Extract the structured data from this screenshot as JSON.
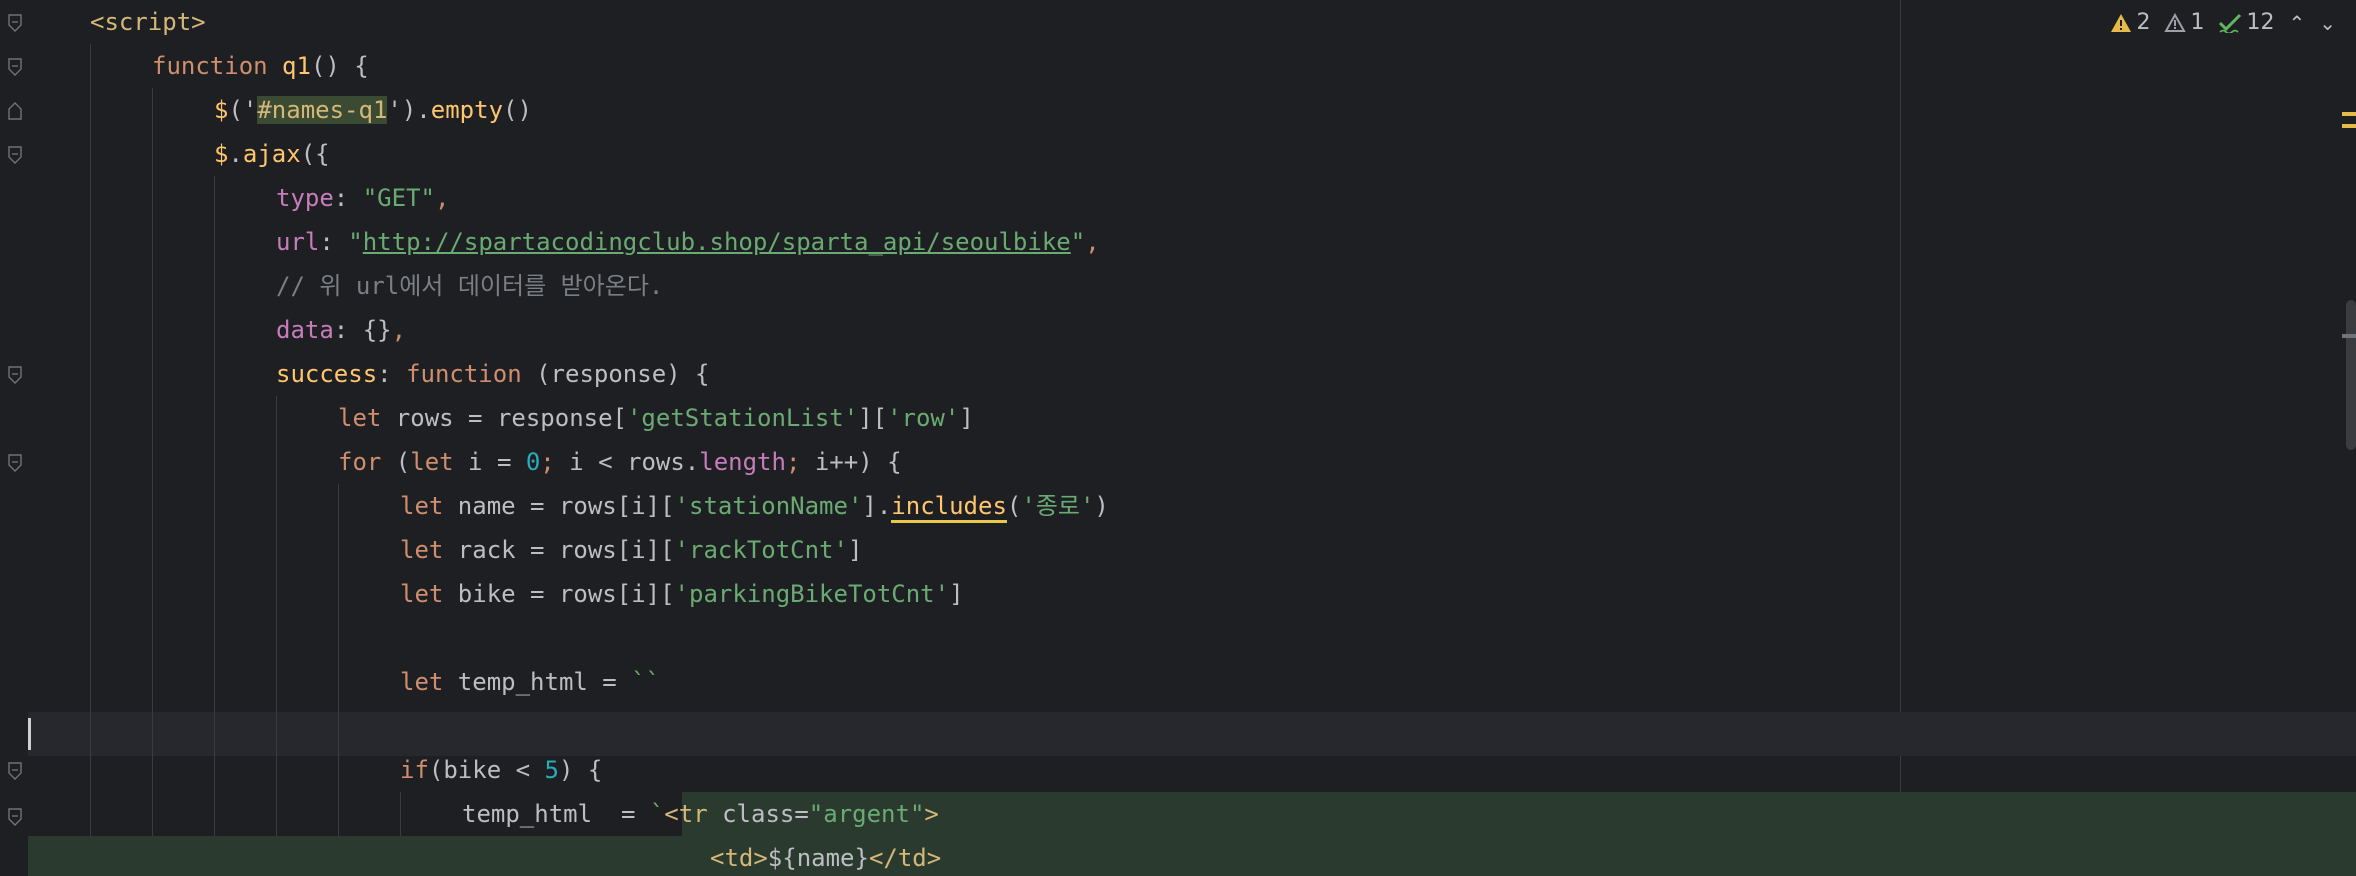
{
  "inspections": {
    "warnings": "2",
    "weak_warnings": "1",
    "typos": "12"
  },
  "code_lines": [
    [
      [
        "t-tag",
        "<script>"
      ]
    ],
    [
      [
        "t-kw",
        "function "
      ],
      [
        "t-call",
        "q1"
      ],
      [
        "t-text",
        "() {"
      ]
    ],
    [
      [
        "t-call",
        "$"
      ],
      [
        "t-text",
        "('"
      ],
      [
        "t-hl",
        "#names-q1"
      ],
      [
        "t-text",
        "')."
      ],
      [
        "t-call",
        "empty"
      ],
      [
        "t-text",
        "()"
      ]
    ],
    [
      [
        "t-call",
        "$"
      ],
      [
        "t-text",
        "."
      ],
      [
        "t-call",
        "ajax"
      ],
      [
        "t-text",
        "({"
      ]
    ],
    [
      [
        "t-prop",
        "type"
      ],
      [
        "t-text",
        ": "
      ],
      [
        "t-str",
        "\"GET\""
      ],
      [
        "t-kw",
        ","
      ]
    ],
    [
      [
        "t-prop",
        "url"
      ],
      [
        "t-text",
        ": "
      ],
      [
        "t-str",
        "\""
      ],
      [
        "t-link",
        "http://spartacodingclub.shop/sparta_api/seoulbike"
      ],
      [
        "t-str",
        "\""
      ],
      [
        "t-kw",
        ","
      ]
    ],
    [
      [
        "t-com",
        "// 위 url에서 데이터를 받아온다."
      ]
    ],
    [
      [
        "t-prop",
        "data"
      ],
      [
        "t-text",
        ": {}"
      ],
      [
        "t-kw",
        ","
      ]
    ],
    [
      [
        "t-call",
        "success"
      ],
      [
        "t-text",
        ": "
      ],
      [
        "t-kw",
        "function "
      ],
      [
        "t-text",
        "(response) {"
      ]
    ],
    [
      [
        "t-kw",
        "let "
      ],
      [
        "t-text",
        "rows = response["
      ],
      [
        "t-str",
        "'getStationList'"
      ],
      [
        "t-text",
        "]["
      ],
      [
        "t-str",
        "'row'"
      ],
      [
        "t-text",
        "]"
      ]
    ],
    [
      [
        "t-kw",
        "for "
      ],
      [
        "t-text",
        "("
      ],
      [
        "t-kw",
        "let "
      ],
      [
        "t-text",
        "i = "
      ],
      [
        "t-num",
        "0"
      ],
      [
        "t-kw",
        "; "
      ],
      [
        "t-text",
        "i < rows."
      ],
      [
        "t-prop",
        "length"
      ],
      [
        "t-kw",
        "; "
      ],
      [
        "t-text",
        "i++) {"
      ]
    ],
    [
      [
        "t-kw",
        "let "
      ],
      [
        "t-text",
        "name = rows[i]["
      ],
      [
        "t-str",
        "'stationName'"
      ],
      [
        "t-text",
        "]."
      ],
      [
        "t-warn",
        "includes"
      ],
      [
        "t-text",
        "("
      ],
      [
        "t-str",
        "'종로'"
      ],
      [
        "t-text",
        ")"
      ]
    ],
    [
      [
        "t-kw",
        "let "
      ],
      [
        "t-text",
        "rack = rows[i]["
      ],
      [
        "t-str",
        "'rackTotCnt'"
      ],
      [
        "t-text",
        "]"
      ]
    ],
    [
      [
        "t-kw",
        "let "
      ],
      [
        "t-text",
        "bike = rows[i]["
      ],
      [
        "t-str",
        "'parkingBikeTotCnt'"
      ],
      [
        "t-text",
        "]"
      ]
    ],
    [],
    [
      [
        "t-kw",
        "let "
      ],
      [
        "t-text",
        "temp_html = "
      ],
      [
        "t-str",
        "``"
      ]
    ],
    [],
    [
      [
        "t-kw",
        "if"
      ],
      [
        "t-text",
        "(bike < "
      ],
      [
        "t-num",
        "5"
      ],
      [
        "t-text",
        ") {"
      ]
    ],
    [
      [
        "t-text",
        "temp_html  = "
      ],
      [
        "t-str",
        "`"
      ],
      [
        "t-tag",
        "<tr "
      ],
      [
        "t-attr",
        "class="
      ],
      [
        "t-str",
        "\"argent\""
      ],
      [
        "t-tag",
        ">"
      ]
    ],
    [
      [
        "t-tag",
        "<td>"
      ],
      [
        "t-text",
        "${name}"
      ],
      [
        "t-tag",
        "</td>"
      ]
    ]
  ]
}
